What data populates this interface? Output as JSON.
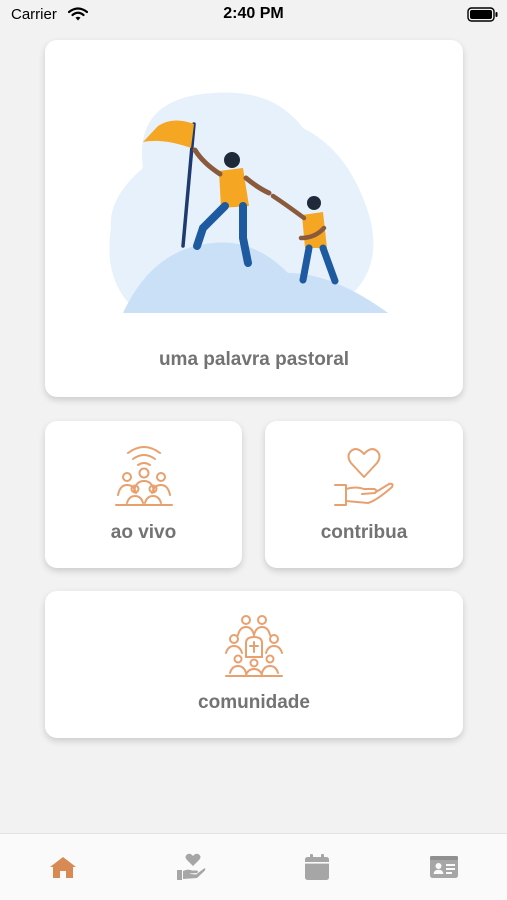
{
  "status_bar": {
    "carrier": "Carrier",
    "time": "2:40 PM"
  },
  "colors": {
    "accent": "#e8a06f",
    "card_text": "#737373",
    "tab_active": "#d88a55",
    "tab_inactive": "#a6a6a6",
    "illustration_orange": "#f5a623",
    "illustration_blue": "#dcebfb"
  },
  "cards": {
    "main": {
      "label": "uma palavra pastoral",
      "illustration": "climbers-helping-hand-illustration"
    },
    "live": {
      "label": "ao vivo",
      "icon": "live-broadcast-group-icon"
    },
    "give": {
      "label": "contribua",
      "icon": "heart-in-hand-icon"
    },
    "community": {
      "label": "comunidade",
      "icon": "community-church-icon"
    }
  },
  "tabbar": {
    "tabs": [
      {
        "icon": "home-icon",
        "active": true
      },
      {
        "icon": "donate-icon",
        "active": false
      },
      {
        "icon": "calendar-icon",
        "active": false
      },
      {
        "icon": "id-card-icon",
        "active": false
      }
    ]
  }
}
